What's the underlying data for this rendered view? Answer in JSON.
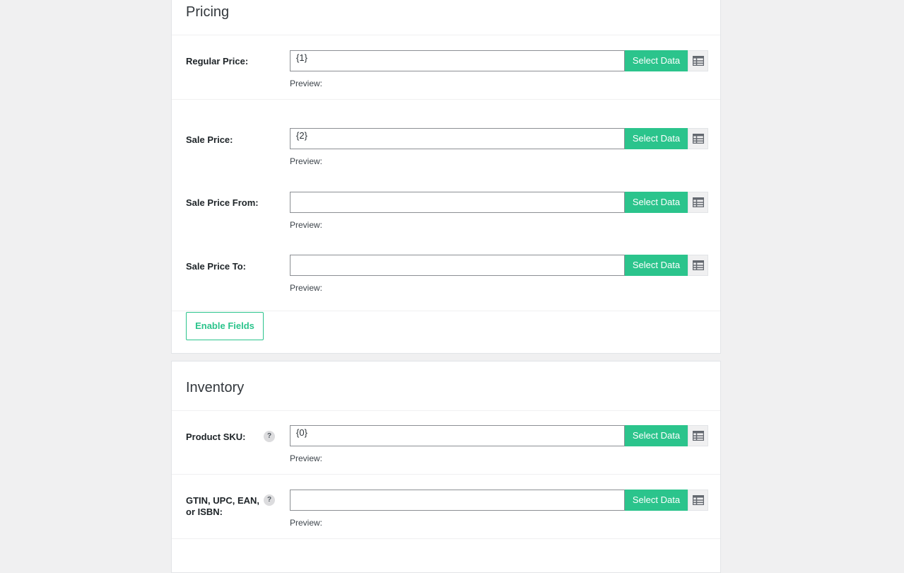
{
  "pricing": {
    "title": "Pricing",
    "select_label": "Select Data",
    "preview_label": "Preview:",
    "fields": [
      {
        "label": "Regular Price:",
        "value": "{1}"
      },
      {
        "label": "Sale Price:",
        "value": "{2}"
      },
      {
        "label": "Sale Price From:",
        "value": ""
      },
      {
        "label": "Sale Price To:",
        "value": ""
      }
    ],
    "enable_fields_label": "Enable Fields"
  },
  "inventory": {
    "title": "Inventory",
    "help_glyph": "?",
    "fields": [
      {
        "label": "Product SKU:",
        "value": "{0}"
      },
      {
        "label": "GTIN, UPC, EAN, or ISBN:",
        "value": ""
      }
    ]
  },
  "colors": {
    "accent": "#2bc48c",
    "background": "#f0f0f1"
  },
  "icons": {
    "grid": "table-grid-icon",
    "help": "help-icon"
  }
}
